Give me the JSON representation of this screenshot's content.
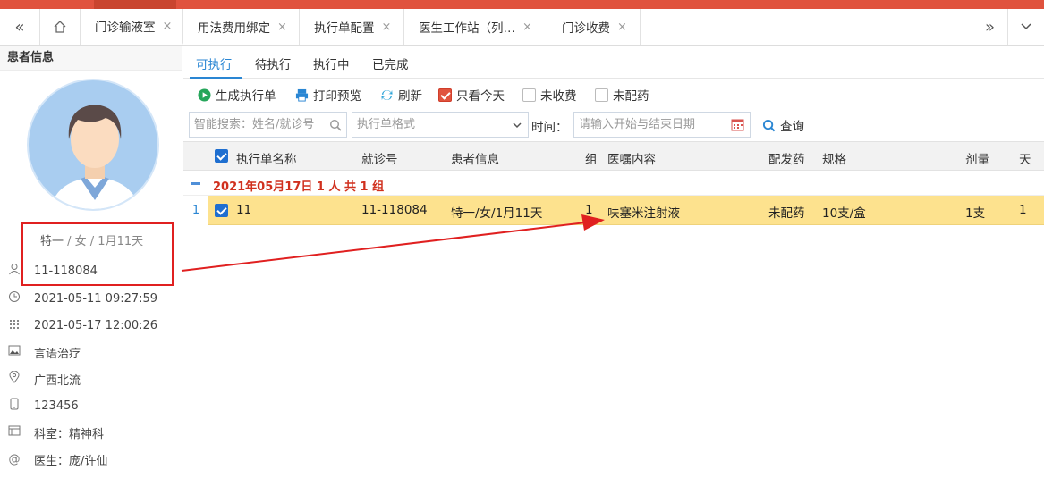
{
  "tabs": [
    {
      "label": "门诊输液室"
    },
    {
      "label": "用法费用绑定"
    },
    {
      "label": "执行单配置"
    },
    {
      "label": "医生工作站（列…"
    },
    {
      "label": "门诊收费"
    }
  ],
  "patient": {
    "title": "患者信息",
    "name": "特一",
    "sex_age": " / 女 / 1月11天",
    "visit_no": "11-118084",
    "visit_time": "2021-05-11 09:27:59",
    "exec_time": "2021-05-17 12:00:26",
    "therapy": "言语治疗",
    "address": "广西北流",
    "phone": "123456",
    "dept": "科室：精神科",
    "doctor": "医生：庞/许仙"
  },
  "subtabs": [
    "可执行",
    "待执行",
    "执行中",
    "已完成"
  ],
  "toolbar": {
    "generate": "生成执行单",
    "print": "打印预览",
    "refresh": "刷新",
    "today_only": "只看今天",
    "unpaid": "未收费",
    "undispensed": "未配药"
  },
  "search": {
    "placeholder": "智能搜索：姓名/就诊号",
    "format_placeholder": "执行单格式",
    "time_label": "时间：",
    "date_placeholder": "请输入开始与结束日期",
    "query": "查询"
  },
  "grid": {
    "headers": [
      "执行单名称",
      "就诊号",
      "患者信息",
      "组",
      "医嘱内容",
      "配发药",
      "规格",
      "剂量",
      "天"
    ],
    "group_title": "2021年05月17日 1 人 共 1 组",
    "rows": [
      {
        "rownum": "1",
        "name": "11",
        "visit_no": "11-118084",
        "patient": "特一/女/1月11天",
        "group": "1",
        "order": "呋塞米注射液",
        "dispense": "未配药",
        "spec": "10支/盒",
        "dose": "1支",
        "days": "1"
      }
    ]
  },
  "colors": {
    "accent": "#2a86d3",
    "topbar": "#e0533e",
    "highlight": "#fde28e",
    "annotation": "#e02020"
  }
}
